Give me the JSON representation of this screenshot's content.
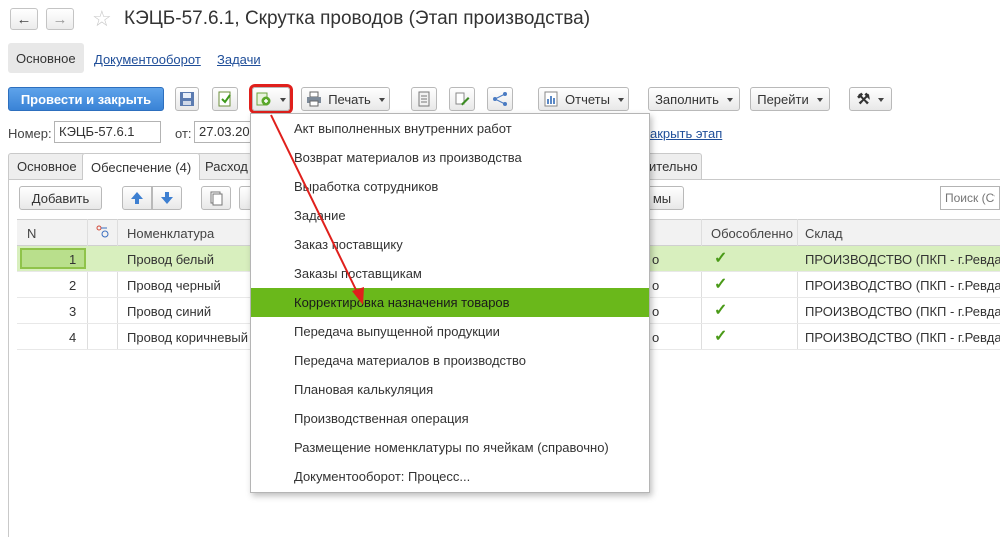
{
  "window": {
    "title": "КЭЦБ-57.6.1, Скрутка проводов (Этап производства)",
    "back_icon": "arrow-left-icon",
    "forward_icon": "arrow-right-icon",
    "favorite_icon": "star-icon"
  },
  "sections": {
    "main": "Основное",
    "docflow": "Документооборот",
    "tasks": "Задачи"
  },
  "toolbar": {
    "post_close": "Провести и закрыть",
    "print": "Печать",
    "reports": "Отчеты",
    "fill": "Заполнить",
    "goto": "Перейти"
  },
  "fields": {
    "number_label": "Номер:",
    "number_value": "КЭЦБ-57.6.1",
    "date_label": "от:",
    "date_value": "27.03.202",
    "close_stage_link": "акрыть этап"
  },
  "tabs": [
    {
      "label": "Основное"
    },
    {
      "label": "Обеспечение (4)"
    },
    {
      "label": "Расход"
    },
    {
      "label": "ительно"
    }
  ],
  "table_toolbar": {
    "add": "Добавить",
    "right_btn": "мы",
    "search_placeholder": "Поиск (Ct"
  },
  "table": {
    "headers": {
      "n": "N",
      "nomenclature": "Номенклатура",
      "separate": "Обособленно",
      "warehouse": "Склад"
    },
    "rows": [
      {
        "n": "1",
        "name": "Провод белый",
        "mid": "о",
        "warehouse": "ПРОИЗВОДСТВО (ПКП - г.Ревда-"
      },
      {
        "n": "2",
        "name": "Провод черный",
        "mid": "о",
        "warehouse": "ПРОИЗВОДСТВО (ПКП - г.Ревда-"
      },
      {
        "n": "3",
        "name": "Провод синий",
        "mid": "о",
        "warehouse": "ПРОИЗВОДСТВО (ПКП - г.Ревда-"
      },
      {
        "n": "4",
        "name": "Провод коричневый",
        "mid": "о",
        "warehouse": "ПРОИЗВОДСТВО (ПКП - г.Ревда-"
      }
    ]
  },
  "menu": {
    "items": [
      "Акт выполненных внутренних работ",
      "Возврат материалов из производства",
      "Выработка сотрудников",
      "Задание",
      "Заказ поставщику",
      "Заказы поставщикам",
      "Корректировка назначения товаров",
      "Передача выпущенной продукции",
      "Передача материалов в производство",
      "Плановая калькуляция",
      "Производственная операция",
      "Размещение номенклатуры по ячейкам (справочно)",
      "Документооборот: Процесс..."
    ],
    "highlighted_index": 6
  },
  "colors": {
    "highlight": "#6ab81b",
    "selected_row": "#d8efbe",
    "annotation": "#e0201c",
    "primary": "#3a83d6"
  }
}
